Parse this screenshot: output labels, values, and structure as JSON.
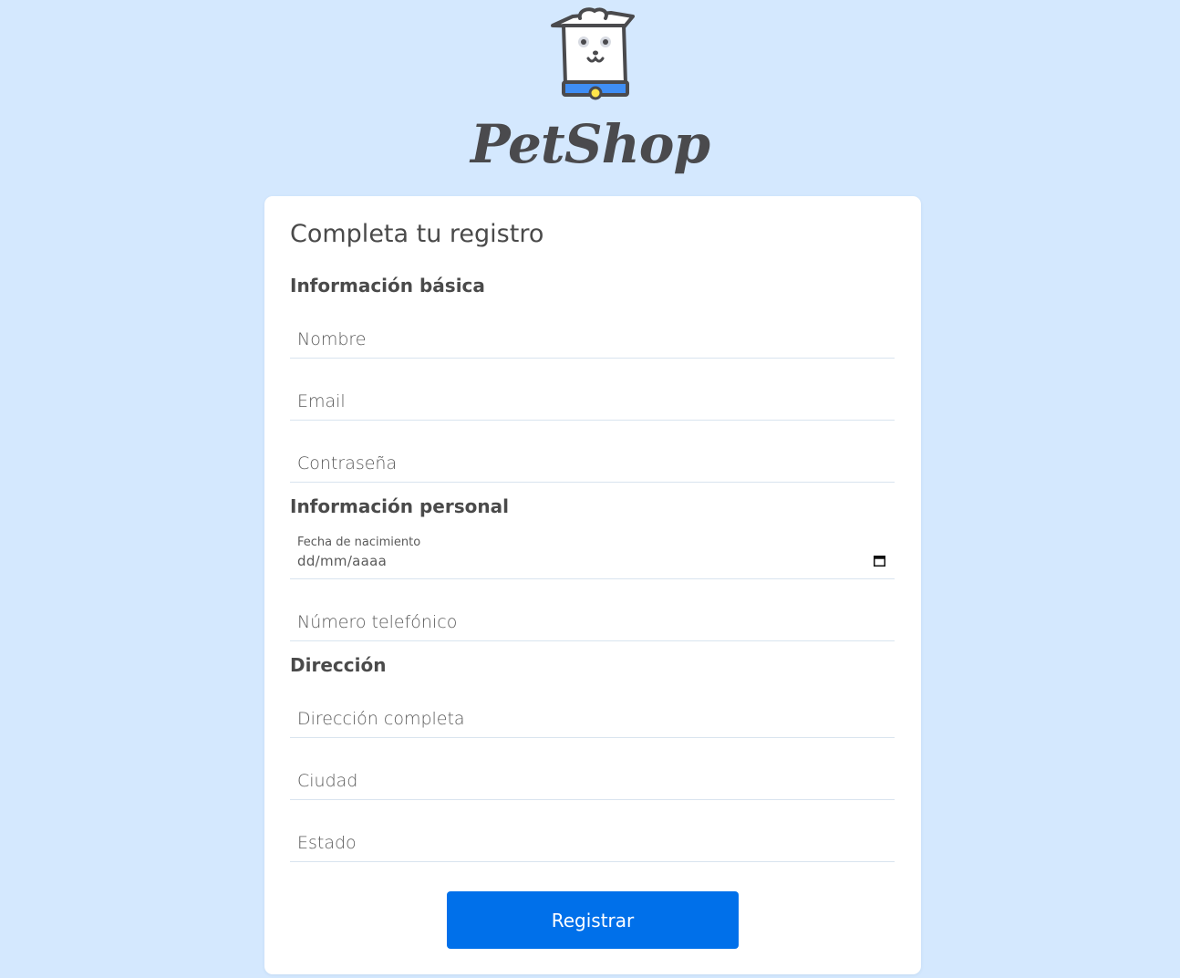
{
  "brand": {
    "name": "PetShop",
    "logo_icon": "dog-mascot-icon",
    "colors": {
      "collar": "#3f8ef5",
      "tag": "#ffe54a",
      "outline": "#4a4a4d"
    }
  },
  "form": {
    "title": "Completa tu registro",
    "sections": {
      "basic": "Información básica",
      "personal": "Información personal",
      "address": "Dirección"
    },
    "fields": {
      "name_placeholder": "Nombre",
      "email_placeholder": "Email",
      "password_placeholder": "Contraseña",
      "birthdate_label": "Fecha de nacimiento",
      "birthdate_placeholder": "dd/mm/aaaa",
      "birthdate_icon": "calendar-icon",
      "phone_placeholder": "Número telefónico",
      "address_placeholder": "Dirección completa",
      "city_placeholder": "Ciudad",
      "state_placeholder": "Estado"
    },
    "submit_label": "Registrar"
  },
  "colors": {
    "background": "#d4e8fe",
    "primary_button": "#0070ea",
    "card": "#ffffff"
  }
}
